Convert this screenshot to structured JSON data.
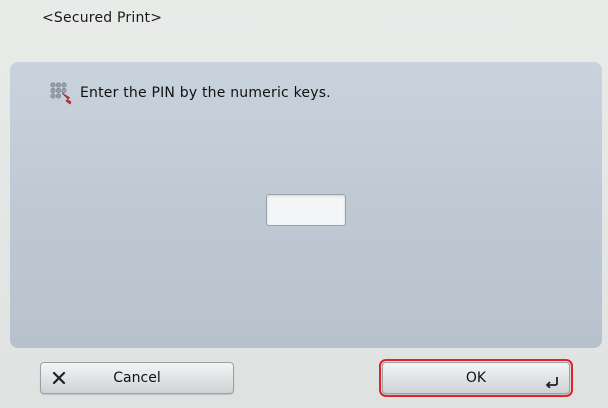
{
  "header": {
    "title": "<Secured Print>"
  },
  "panel": {
    "instruction": "Enter the PIN by the numeric keys.",
    "instruction_icon": "numeric-keypad-icon",
    "pin_value": ""
  },
  "footer": {
    "cancel_label": "Cancel",
    "cancel_icon": "close-x-icon",
    "ok_label": "OK",
    "ok_icon": "enter-return-icon"
  },
  "colors": {
    "highlight": "#e2222b",
    "panel": "#c3cdd8"
  }
}
